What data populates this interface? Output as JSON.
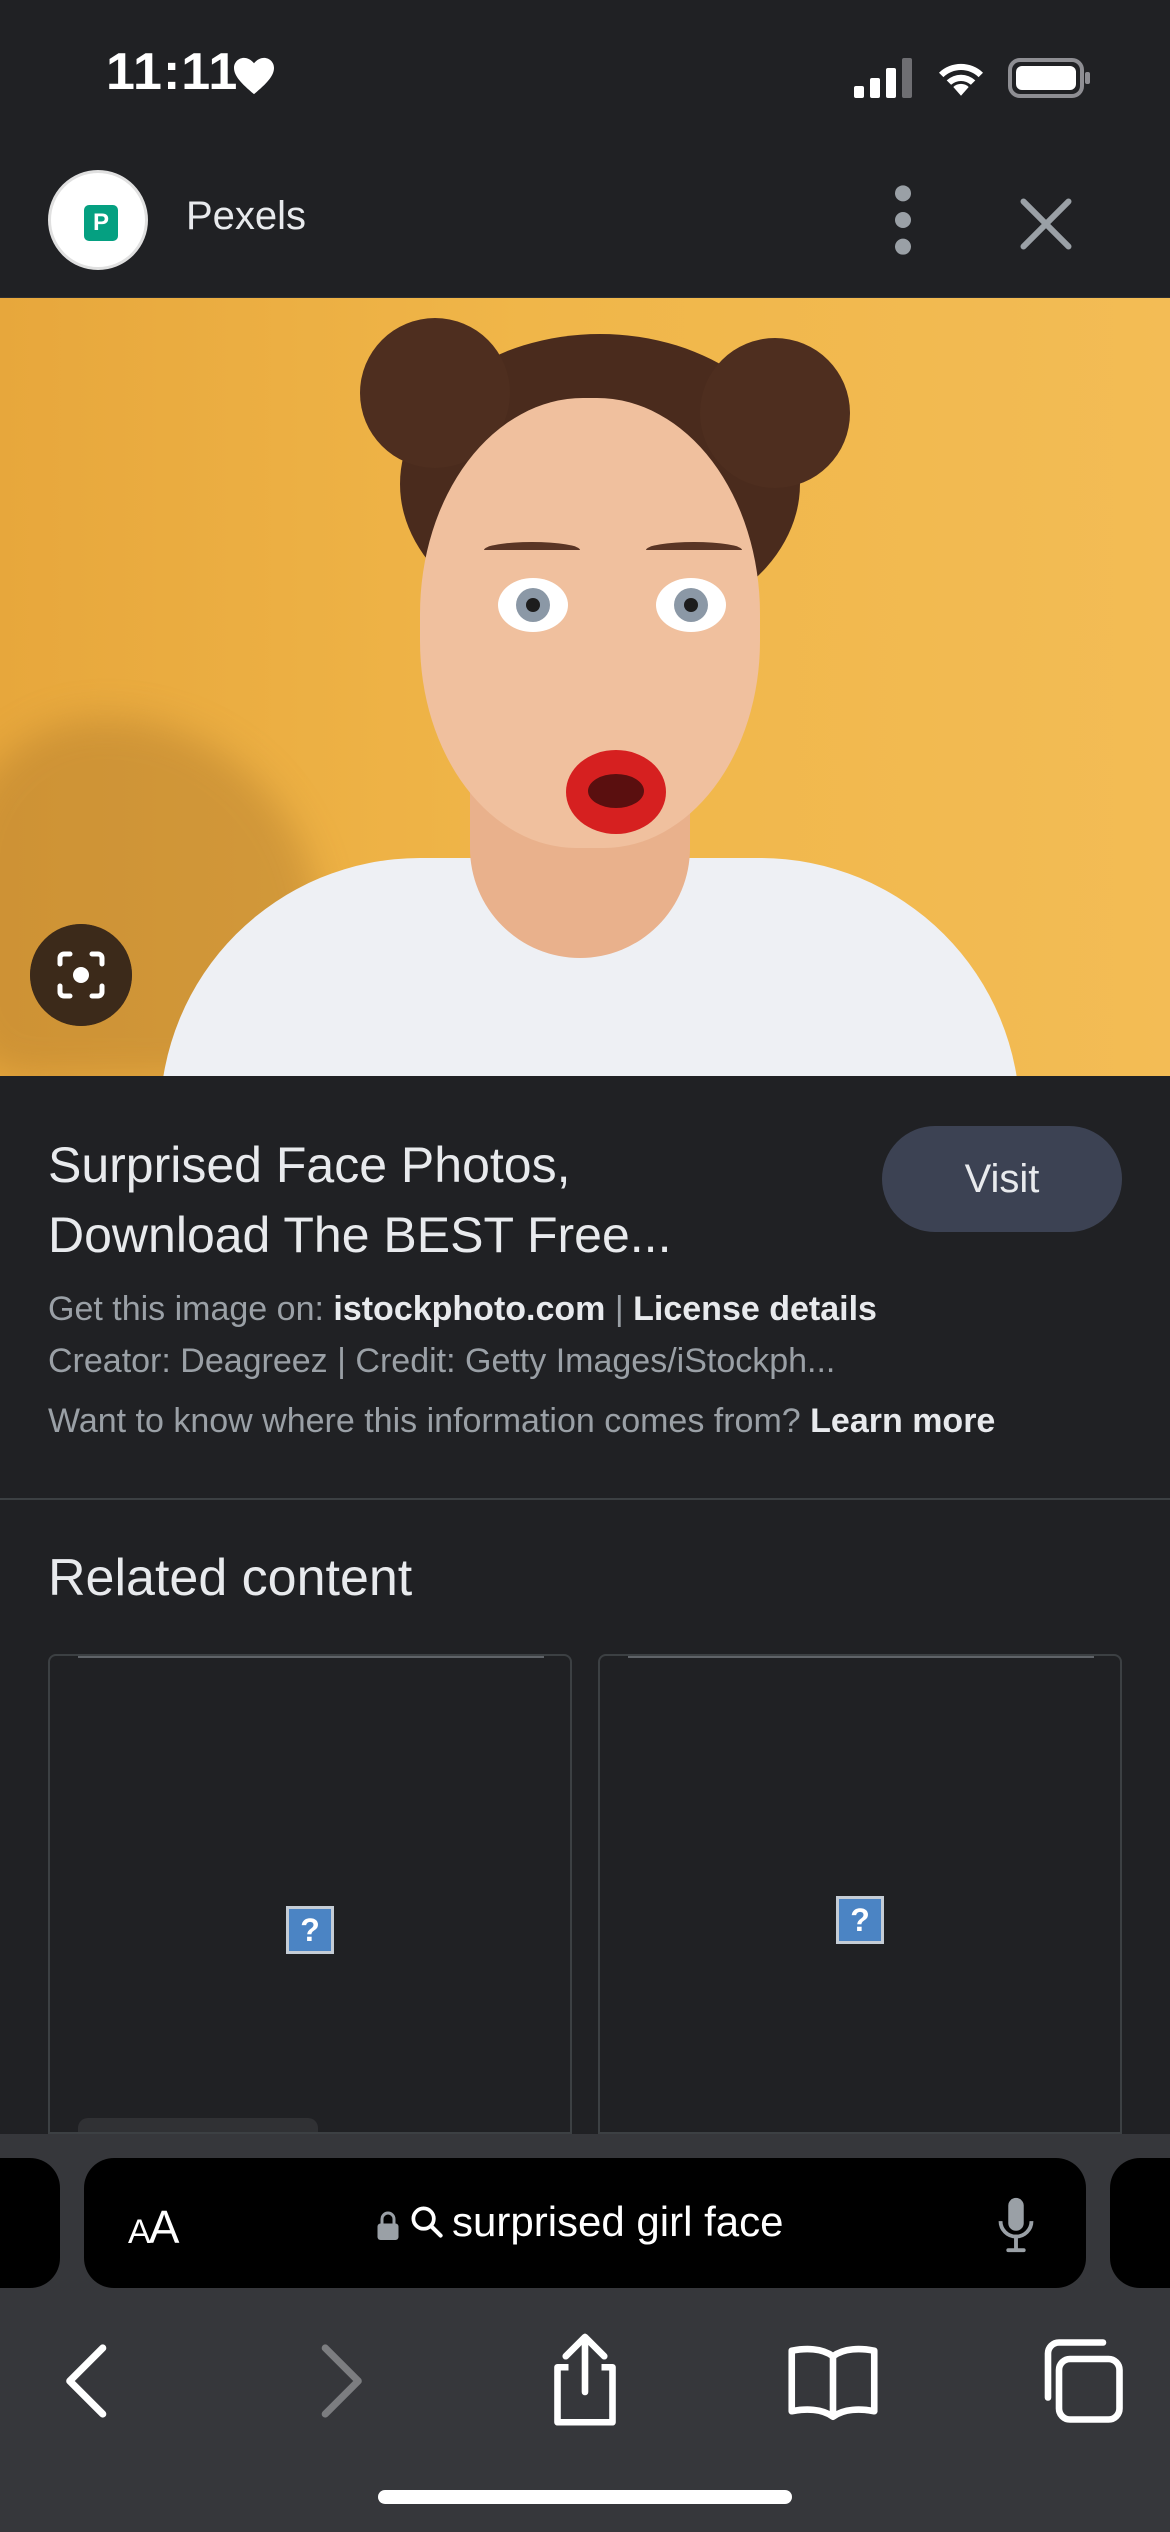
{
  "status_bar": {
    "time": "11:11"
  },
  "header": {
    "site_name": "Pexels",
    "logo_letter": "P"
  },
  "result": {
    "title_line1": "Surprised Face Photos,",
    "title_line2": "Download The BEST Free...",
    "visit_label": "Visit",
    "get_image_prefix": "Get this image on: ",
    "source_domain": "istockphoto.com",
    "separator": " | ",
    "license_label": "License details",
    "creator_line": "Creator: Deagreez | Credit: Getty Images/iStockph...",
    "info_question": "Want to know where this information comes from? ",
    "learn_more": "Learn more"
  },
  "related": {
    "title": "Related content",
    "broken_image_glyph": "?"
  },
  "safari": {
    "aa_small": "A",
    "aa_large": "A",
    "search_query": "surprised girl face"
  },
  "colors": {
    "background": "#202124",
    "visit_button": "#3c4253",
    "hero_background": "#f0b649",
    "toolbar": "#36373b"
  },
  "icons": [
    "heart-icon",
    "cellular-signal-icon",
    "wifi-icon",
    "battery-icon",
    "more-vert-icon",
    "close-icon",
    "lens-icon",
    "lock-icon",
    "search-icon",
    "microphone-icon",
    "back-icon",
    "forward-icon",
    "share-icon",
    "bookmarks-icon",
    "tabs-icon"
  ]
}
